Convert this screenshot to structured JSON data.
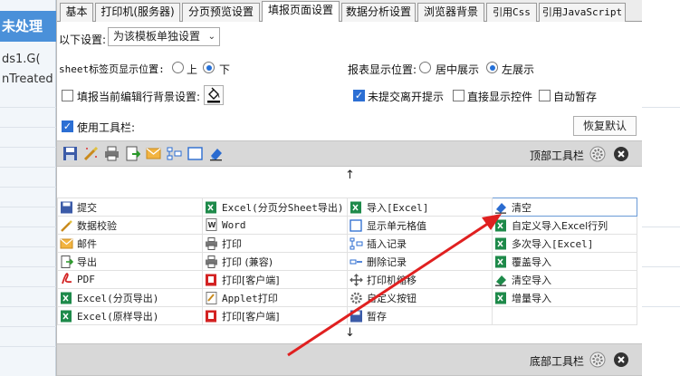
{
  "background": {
    "title": "未处理",
    "line1": "ds1.G(",
    "line2": "nTreated"
  },
  "tabs": [
    {
      "label": "基本"
    },
    {
      "label": "打印机(服务器)"
    },
    {
      "label": "分页预览设置"
    },
    {
      "label": "填报页面设置"
    },
    {
      "label": "数据分析设置"
    },
    {
      "label": "浏览器背景"
    },
    {
      "label": "引用Css"
    },
    {
      "label": "引用JavaScript"
    }
  ],
  "settings": {
    "scope_label": "以下设置:",
    "scope_value": "为该模板单独设置",
    "sheet_pos_label": "sheet标签页显示位置:",
    "sheet_pos_top": "上",
    "sheet_pos_bottom": "下",
    "report_pos_label": "报表显示位置:",
    "report_pos_center": "居中展示",
    "report_pos_left": "左展示",
    "fill_bg_label": "填报当前编辑行背景设置:",
    "unsubmitted_label": "未提交离开提示",
    "direct_show_label": "直接显示控件",
    "autosave_label": "自动暂存",
    "use_toolbar_label": "使用工具栏:",
    "restore_default": "恢复默认"
  },
  "toolbar": {
    "top_label": "顶部工具栏",
    "bottom_label": "底部工具栏",
    "up_arrow": "↑",
    "down_arrow": "↓"
  },
  "items": [
    [
      "提交",
      "Excel(分页分Sheet导出)",
      "导入[Excel]",
      "清空"
    ],
    [
      "数据校验",
      "Word",
      "显示单元格值",
      "自定义导入Excel行列"
    ],
    [
      "邮件",
      "打印",
      "插入记录",
      "多次导入[Excel]"
    ],
    [
      "导出",
      "打印 (兼容)",
      "删除记录",
      "覆盖导入"
    ],
    [
      "PDF",
      "打印[客户端]",
      "打印机缩移",
      "清空导入"
    ],
    [
      "Excel(分页导出)",
      "Applet打印",
      "自定义按钮",
      "增量导入"
    ],
    [
      "Excel(原样导出)",
      "打印[客户端]",
      "暂存",
      ""
    ]
  ],
  "colors": {
    "accent": "#2c6fd4",
    "annotation_arrow": "#e02020",
    "toolbar_bg": "#d8d8d8"
  }
}
